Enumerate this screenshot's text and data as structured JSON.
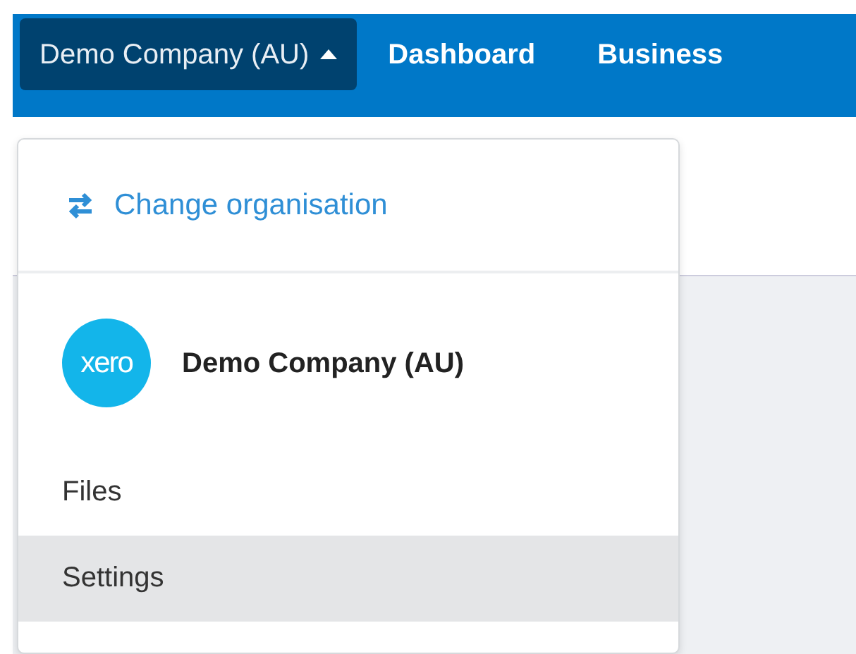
{
  "navbar": {
    "org_switcher": {
      "label": "Demo Company (AU)",
      "expanded": true
    },
    "links": [
      {
        "label": "Dashboard"
      },
      {
        "label": "Business"
      }
    ]
  },
  "org_menu": {
    "change_link": {
      "label": "Change organisation"
    },
    "organisation": {
      "logo_text": "xero",
      "name": "Demo Company (AU)"
    },
    "items": [
      {
        "label": "Files",
        "selected": false
      },
      {
        "label": "Settings",
        "selected": true
      }
    ]
  }
}
